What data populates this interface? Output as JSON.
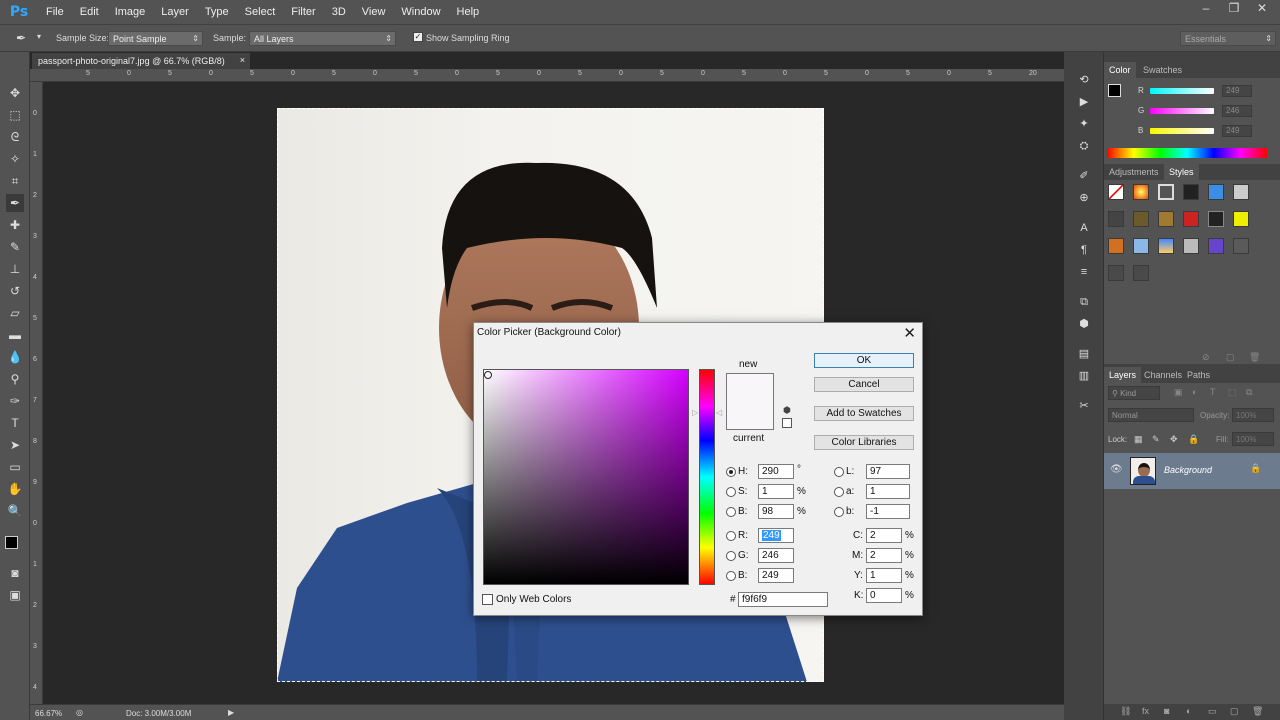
{
  "app": {
    "logo": "Ps"
  },
  "menu": [
    "File",
    "Edit",
    "Image",
    "Layer",
    "Type",
    "Select",
    "Filter",
    "3D",
    "View",
    "Window",
    "Help"
  ],
  "options": {
    "sample_size_label": "Sample Size:",
    "sample_size_value": "Point Sample",
    "sample_label": "Sample:",
    "sample_value": "All Layers",
    "show_ring_label": "Show Sampling Ring",
    "workspace": "Essentials"
  },
  "document": {
    "tab_title": "passport-photo-original7.jpg @ 66.7% (RGB/8)",
    "zoom": "66.67%",
    "doc_size": "Doc: 3.00M/3.00M",
    "ruler_h": [
      "5",
      "0",
      "5",
      "0",
      "5",
      "0",
      "5",
      "0",
      "5",
      "0",
      "5",
      "0",
      "5",
      "0",
      "5",
      "0",
      "5",
      "0",
      "5",
      "0",
      "5",
      "0",
      "5",
      "20"
    ],
    "ruler_v": [
      "0",
      "1",
      "2",
      "3",
      "4",
      "5",
      "6",
      "7",
      "8",
      "9",
      "0",
      "1",
      "2",
      "3",
      "4"
    ]
  },
  "color_panel": {
    "tabs": [
      "Color",
      "Swatches"
    ],
    "r_label": "R",
    "g_label": "G",
    "b_label": "B",
    "r": "249",
    "g": "246",
    "b": "249"
  },
  "styles_panel": {
    "tabs": [
      "Adjustments",
      "Styles"
    ]
  },
  "layers_panel": {
    "tabs": [
      "Layers",
      "Channels",
      "Paths"
    ],
    "kind": "Kind",
    "blend": "Normal",
    "opacity_label": "Opacity:",
    "opacity": "100%",
    "lock_label": "Lock:",
    "fill_label": "Fill:",
    "fill": "100%",
    "layer_name": "Background"
  },
  "dialog": {
    "title": "Color Picker (Background Color)",
    "new_label": "new",
    "current_label": "current",
    "ok": "OK",
    "cancel": "Cancel",
    "add_swatches": "Add to Swatches",
    "color_libraries": "Color Libraries",
    "only_web": "Only Web Colors",
    "h_label": "H:",
    "h": "290",
    "h_unit": "°",
    "s_label": "S:",
    "s": "1",
    "s_unit": "%",
    "bb_label": "B:",
    "bb": "98",
    "bb_unit": "%",
    "r_label": "R:",
    "r": "249",
    "g_label": "G:",
    "g": "246",
    "b_label": "B:",
    "b": "249",
    "l_label": "L:",
    "l": "97",
    "a_label": "a:",
    "a": "1",
    "lb_label": "b:",
    "lb": "-1",
    "c_label": "C:",
    "c": "2",
    "c_unit": "%",
    "m_label": "M:",
    "m": "2",
    "m_unit": "%",
    "y_label": "Y:",
    "y": "1",
    "y_unit": "%",
    "k_label": "K:",
    "k": "0",
    "k_unit": "%",
    "hex_label": "#",
    "hex": "f9f6f9",
    "selected_color": "#f9f6f9"
  }
}
